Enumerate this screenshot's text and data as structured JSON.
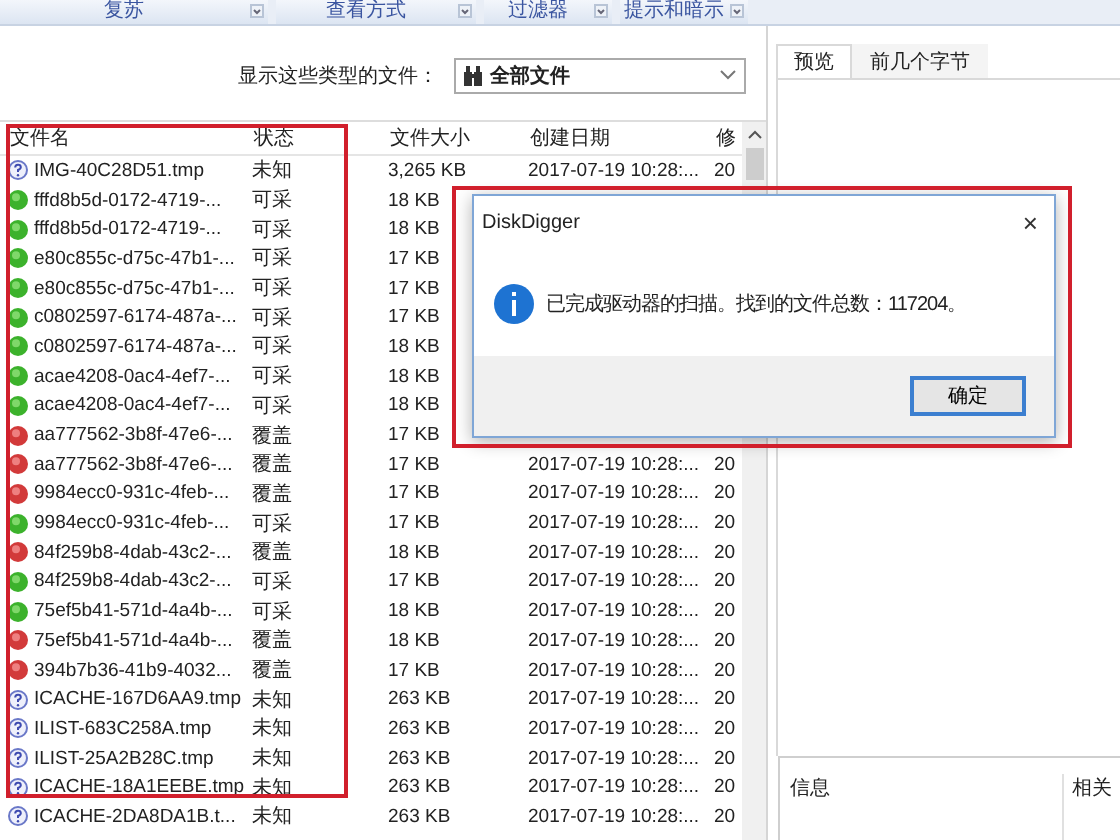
{
  "toolbar": [
    {
      "label": "复苏"
    },
    {
      "label": "查看方式"
    },
    {
      "label": "过滤器"
    },
    {
      "label": "提示和暗示"
    }
  ],
  "filter": {
    "label": "显示这些类型的文件：",
    "value": "全部文件"
  },
  "table": {
    "columns": [
      "文件名",
      "状态",
      "文件大小",
      "创建日期",
      "修"
    ],
    "rows": [
      {
        "kind": "unknown",
        "name": "IMG-40C28D51.tmp",
        "status": "未知",
        "size": "3,265 KB",
        "date": "2017-07-19 10:28:...",
        "column_5": "20"
      },
      {
        "kind": "recoverable",
        "name": "fffd8b5d-0172-4719-...",
        "status": "可采",
        "size": "18 KB"
      },
      {
        "kind": "recoverable",
        "name": "fffd8b5d-0172-4719-...",
        "status": "可采",
        "size": "18 KB"
      },
      {
        "kind": "recoverable",
        "name": "e80c855c-d75c-47b1-...",
        "status": "可采",
        "size": "17 KB"
      },
      {
        "kind": "recoverable",
        "name": "e80c855c-d75c-47b1-...",
        "status": "可采",
        "size": "17 KB"
      },
      {
        "kind": "recoverable",
        "name": "c0802597-6174-487a-...",
        "status": "可采",
        "size": "17 KB"
      },
      {
        "kind": "recoverable",
        "name": "c0802597-6174-487a-...",
        "status": "可采",
        "size": "18 KB"
      },
      {
        "kind": "recoverable",
        "name": "acae4208-0ac4-4ef7-...",
        "status": "可采",
        "size": "18 KB"
      },
      {
        "kind": "recoverable",
        "name": "acae4208-0ac4-4ef7-...",
        "status": "可采",
        "size": "18 KB"
      },
      {
        "kind": "overwritten",
        "name": "aa777562-3b8f-47e6-...",
        "status": "覆盖",
        "size": "17 KB"
      },
      {
        "kind": "overwritten",
        "name": "aa777562-3b8f-47e6-...",
        "status": "覆盖",
        "size": "17 KB",
        "date": "2017-07-19 10:28:...",
        "column_5": "20"
      },
      {
        "kind": "overwritten",
        "name": "9984ecc0-931c-4feb-...",
        "status": "覆盖",
        "size": "17 KB",
        "date": "2017-07-19 10:28:...",
        "column_5": "20"
      },
      {
        "kind": "recoverable",
        "name": "9984ecc0-931c-4feb-...",
        "status": "可采",
        "size": "17 KB",
        "date": "2017-07-19 10:28:...",
        "column_5": "20"
      },
      {
        "kind": "overwritten",
        "name": "84f259b8-4dab-43c2-...",
        "status": "覆盖",
        "size": "18 KB",
        "date": "2017-07-19 10:28:...",
        "column_5": "20"
      },
      {
        "kind": "recoverable",
        "name": "84f259b8-4dab-43c2-...",
        "status": "可采",
        "size": "17 KB",
        "date": "2017-07-19 10:28:...",
        "column_5": "20"
      },
      {
        "kind": "recoverable",
        "name": "75ef5b41-571d-4a4b-...",
        "status": "可采",
        "size": "18 KB",
        "date": "2017-07-19 10:28:...",
        "column_5": "20"
      },
      {
        "kind": "overwritten",
        "name": "75ef5b41-571d-4a4b-...",
        "status": "覆盖",
        "size": "18 KB",
        "date": "2017-07-19 10:28:...",
        "column_5": "20"
      },
      {
        "kind": "overwritten",
        "name": "394b7b36-41b9-4032...",
        "status": "覆盖",
        "size": "17 KB",
        "date": "2017-07-19 10:28:...",
        "column_5": "20"
      },
      {
        "kind": "unknown",
        "name": "ICACHE-167D6AA9.tmp",
        "status": "未知",
        "size": "263 KB",
        "date": "2017-07-19 10:28:...",
        "column_5": "20"
      },
      {
        "kind": "unknown",
        "name": "ILIST-683C258A.tmp",
        "status": "未知",
        "size": "263 KB",
        "date": "2017-07-19 10:28:...",
        "column_5": "20"
      },
      {
        "kind": "unknown",
        "name": "ILIST-25A2B28C.tmp",
        "status": "未知",
        "size": "263 KB",
        "date": "2017-07-19 10:28:...",
        "column_5": "20"
      },
      {
        "kind": "unknown",
        "name": "ICACHE-18A1EEBE.tmp",
        "status": "未知",
        "size": "263 KB",
        "date": "2017-07-19 10:28:...",
        "column_5": "20"
      },
      {
        "kind": "unknown",
        "name": "ICACHE-2DA8DA1B.t...",
        "status": "未知",
        "size": "263 KB",
        "date": "2017-07-19 10:28:...",
        "column_5": "20"
      }
    ]
  },
  "preview_tabs": [
    {
      "label": "预览",
      "selected": true
    },
    {
      "label": "前几个字节",
      "selected": false
    }
  ],
  "info_panel": {
    "info_label": "信息",
    "related_label": "相关"
  },
  "dialog": {
    "title": "DiskDigger",
    "close": "×",
    "message": "已完成驱动器的扫描。找到的文件总数：117204。",
    "button": "确定"
  }
}
